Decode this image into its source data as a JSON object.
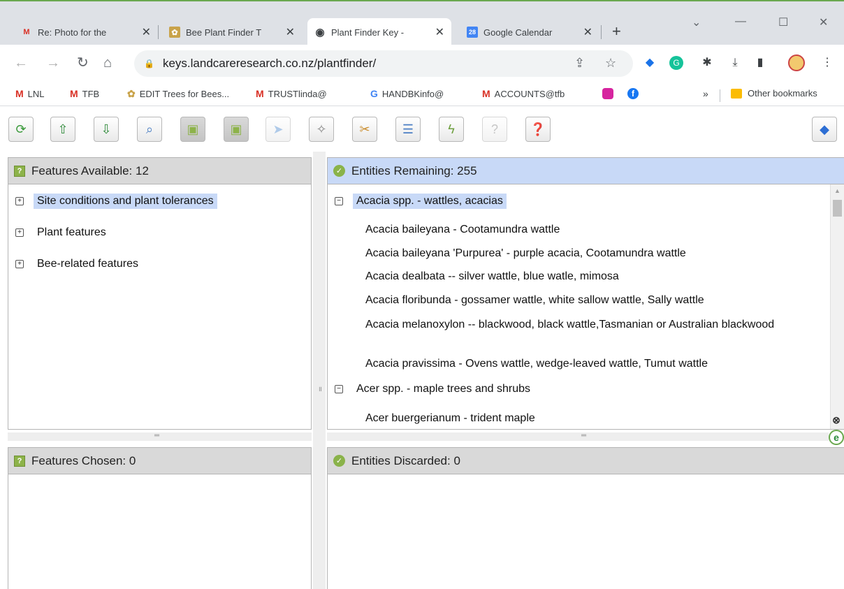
{
  "browser": {
    "tabs": [
      {
        "label": "Re: Photo for the",
        "icon": "gmail-icon"
      },
      {
        "label": "Bee Plant Finder T",
        "icon": "bee-icon"
      },
      {
        "label": "Plant Finder Key -",
        "icon": "globe-icon"
      },
      {
        "label": "Google Calendar",
        "icon": "calendar-icon",
        "badge": "28"
      }
    ],
    "new_tab": "+",
    "url": "keys.landcareresearch.co.nz/plantfinder/",
    "bookmarks": [
      {
        "label": "LNL",
        "icon": "gmail-icon"
      },
      {
        "label": "TFB",
        "icon": "gmail-icon"
      },
      {
        "label": "EDIT Trees for Bees...",
        "icon": "bee-icon"
      },
      {
        "label": "TRUSTlinda@",
        "icon": "gmail-icon"
      },
      {
        "label": "HANDBKinfo@",
        "icon": "google-icon"
      },
      {
        "label": "ACCOUNTS@tfb",
        "icon": "gmail-icon"
      }
    ],
    "bookmarks_overflow": "»",
    "other_bookmarks": "Other bookmarks"
  },
  "panels": {
    "features_available": {
      "title": "Features Available: 12",
      "items": [
        "Site conditions and plant tolerances",
        "Plant features",
        "Bee-related features"
      ]
    },
    "entities_remaining": {
      "title": "Entities Remaining: 255",
      "group1": "Acacia spp.  -  wattles, acacias",
      "entities1": [
        "Acacia baileyana  -  Cootamundra wattle",
        "Acacia baileyana 'Purpurea'  -  purple acacia, Cootamundra wattle",
        "Acacia dealbata -- silver wattle, blue watle, mimosa",
        "Acacia floribunda  -  gossamer wattle, white sallow wattle, Sally wattle",
        "Acacia melanoxylon --  blackwood, black wattle,Tasmanian or Australian blackwood",
        "Acacia pravissima  -  Ovens wattle, wedge-leaved wattle, Tumut wattle"
      ],
      "group2": "Acer spp.  -  maple trees and shrubs",
      "entities2": [
        "Acer buergerianum  -  trident maple"
      ]
    },
    "features_chosen": {
      "title": "Features Chosen: 0"
    },
    "entities_discarded": {
      "title": "Entities Discarded: 0"
    }
  },
  "colors": {
    "selection": "#c8d9f7",
    "panel_header": "#d9d9d9",
    "accent_green": "#8db34a"
  }
}
